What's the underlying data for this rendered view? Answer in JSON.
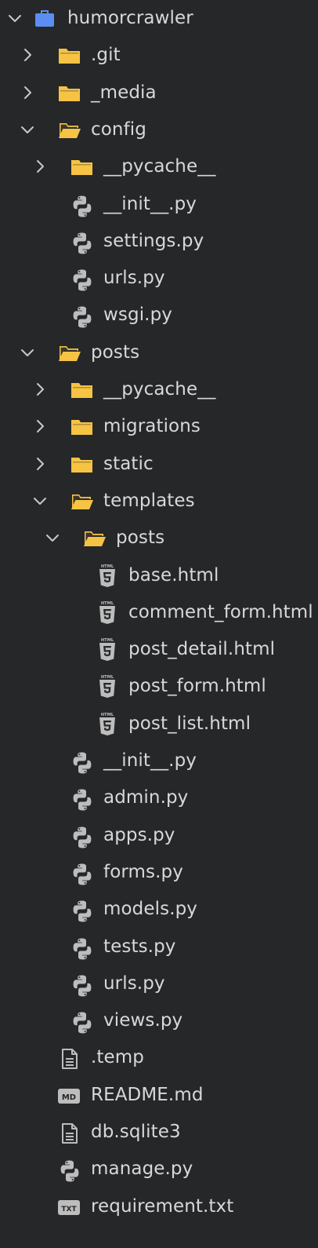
{
  "explorer": {
    "root": {
      "label": "humorcrawler",
      "icon": "project-folder-icon",
      "state": "expanded"
    },
    "items": [
      {
        "label": ".git",
        "type": "folder",
        "state": "collapsed",
        "depth": 1
      },
      {
        "label": "_media",
        "type": "folder",
        "state": "collapsed",
        "depth": 1
      },
      {
        "label": "config",
        "type": "folder",
        "state": "expanded",
        "depth": 1
      },
      {
        "label": "__pycache__",
        "type": "folder",
        "state": "collapsed",
        "depth": 2
      },
      {
        "label": "__init__.py",
        "type": "python",
        "depth": 2
      },
      {
        "label": "settings.py",
        "type": "python",
        "depth": 2
      },
      {
        "label": "urls.py",
        "type": "python",
        "depth": 2
      },
      {
        "label": "wsgi.py",
        "type": "python",
        "depth": 2
      },
      {
        "label": "posts",
        "type": "folder",
        "state": "expanded",
        "depth": 1
      },
      {
        "label": "__pycache__",
        "type": "folder",
        "state": "collapsed",
        "depth": 2
      },
      {
        "label": "migrations",
        "type": "folder",
        "state": "collapsed",
        "depth": 2
      },
      {
        "label": "static",
        "type": "folder",
        "state": "collapsed",
        "depth": 2
      },
      {
        "label": "templates",
        "type": "folder",
        "state": "expanded",
        "depth": 2
      },
      {
        "label": "posts",
        "type": "folder",
        "state": "expanded",
        "depth": 3
      },
      {
        "label": "base.html",
        "type": "html",
        "depth": 4
      },
      {
        "label": "comment_form.html",
        "type": "html",
        "depth": 4
      },
      {
        "label": "post_detail.html",
        "type": "html",
        "depth": 4
      },
      {
        "label": "post_form.html",
        "type": "html",
        "depth": 4
      },
      {
        "label": "post_list.html",
        "type": "html",
        "depth": 4
      },
      {
        "label": "__init__.py",
        "type": "python",
        "depth": 2
      },
      {
        "label": "admin.py",
        "type": "python",
        "depth": 2
      },
      {
        "label": "apps.py",
        "type": "python",
        "depth": 2
      },
      {
        "label": "forms.py",
        "type": "python",
        "depth": 2
      },
      {
        "label": "models.py",
        "type": "python",
        "depth": 2
      },
      {
        "label": "tests.py",
        "type": "python",
        "depth": 2
      },
      {
        "label": "urls.py",
        "type": "python",
        "depth": 2
      },
      {
        "label": "views.py",
        "type": "python",
        "depth": 2
      },
      {
        "label": ".temp",
        "type": "text",
        "depth": 1
      },
      {
        "label": "README.md",
        "type": "markdown",
        "badge": "MD",
        "depth": 1
      },
      {
        "label": "db.sqlite3",
        "type": "text",
        "depth": 1
      },
      {
        "label": "manage.py",
        "type": "python",
        "depth": 1
      },
      {
        "label": "requirement.txt",
        "type": "txt",
        "badge": "TXT",
        "depth": 1
      }
    ]
  },
  "badges": {
    "html5": "HTML"
  },
  "colors": {
    "background": "#262729",
    "text": "#d8d8d8",
    "folder": "#f6c344",
    "project": "#5b8df3",
    "file_icon": "#bdbdbd",
    "chevron": "#c8c8c8"
  }
}
